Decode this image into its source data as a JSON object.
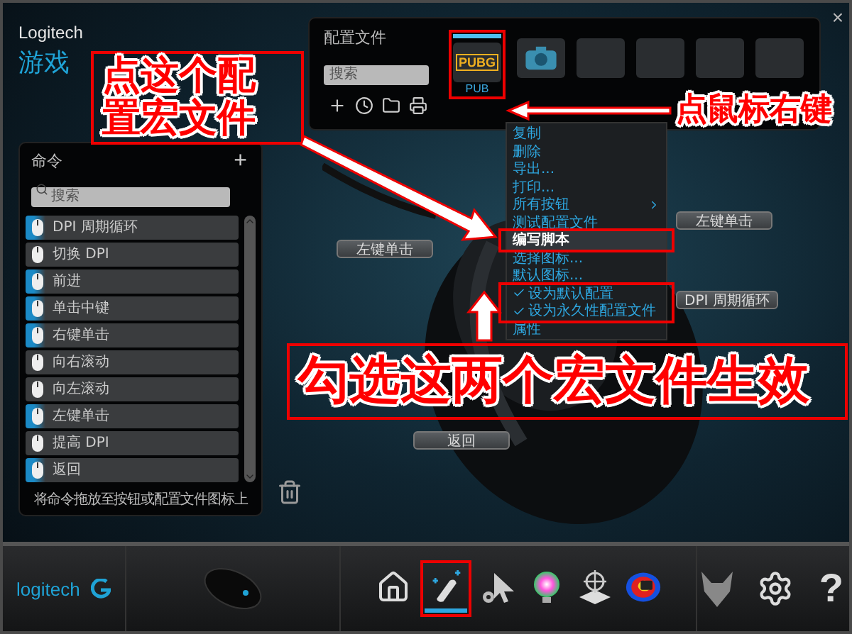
{
  "window": {
    "close": "×"
  },
  "app_title": {
    "brand": "Logitech",
    "name": "游戏"
  },
  "profiles": {
    "title": "配置文件",
    "search_placeholder": "搜索",
    "items": [
      {
        "kind": "pubg",
        "logo": "PUBG",
        "label": "PUB",
        "selected": true,
        "annotated": true
      },
      {
        "kind": "camera",
        "selected": false,
        "annotated": false
      },
      {
        "kind": "empty",
        "selected": false,
        "annotated": false
      },
      {
        "kind": "empty",
        "selected": false,
        "annotated": false
      },
      {
        "kind": "empty",
        "selected": false,
        "annotated": false
      },
      {
        "kind": "empty",
        "selected": false,
        "annotated": false
      }
    ]
  },
  "commands": {
    "title": "命令",
    "add": "+",
    "search_placeholder": "搜索",
    "items": [
      {
        "label": "DPI 周期循环",
        "assigned": true
      },
      {
        "label": "切换 DPI",
        "assigned": false
      },
      {
        "label": "前进",
        "assigned": true
      },
      {
        "label": "单击中键",
        "assigned": true
      },
      {
        "label": "右键单击",
        "assigned": true
      },
      {
        "label": "向右滚动",
        "assigned": false
      },
      {
        "label": "向左滚动",
        "assigned": false
      },
      {
        "label": "左键单击",
        "assigned": true
      },
      {
        "label": "提高 DPI",
        "assigned": false
      },
      {
        "label": "返回",
        "assigned": true
      }
    ],
    "hint": "将命令拖放至按钮或配置文件图标上"
  },
  "mouse_buttons": [
    {
      "label": "左键单击"
    },
    {
      "label": "左键单击"
    },
    {
      "label": "DPI 周期循环"
    },
    {
      "label": "返回"
    }
  ],
  "context_menu": [
    {
      "label": "复制",
      "kind": "item",
      "selected": false,
      "annotated": false
    },
    {
      "label": "删除",
      "kind": "item",
      "selected": false,
      "annotated": false
    },
    {
      "label": "导出...",
      "kind": "item",
      "selected": false,
      "annotated": false
    },
    {
      "label": "打印...",
      "kind": "item",
      "selected": false,
      "annotated": false
    },
    {
      "label": "所有按钮",
      "kind": "submenu",
      "selected": false,
      "annotated": false
    },
    {
      "label": "测试配置文件",
      "kind": "item",
      "selected": false,
      "annotated": false
    },
    {
      "label": "编写脚本",
      "kind": "item",
      "selected": true,
      "annotated": true
    },
    {
      "label": "选择图标...",
      "kind": "item",
      "selected": false,
      "annotated": false
    },
    {
      "label": "默认图标...",
      "kind": "item",
      "selected": false,
      "annotated": false
    },
    {
      "label": "设为默认配置",
      "kind": "check",
      "checked": true,
      "selected": false,
      "annotated": true
    },
    {
      "label": "设为永久性配置文件",
      "kind": "check",
      "checked": true,
      "selected": false,
      "annotated": true
    },
    {
      "label": "属性",
      "kind": "item",
      "selected": false,
      "annotated": false
    }
  ],
  "annotations": [
    {
      "text": "点这个配置宏文件"
    },
    {
      "text": "点鼠标右键"
    },
    {
      "text": "勾选这两个宏文件生效"
    }
  ],
  "bottom_bar": {
    "logo": "logitech",
    "tools": [
      {
        "kind": "home",
        "selected": false,
        "annotated": false
      },
      {
        "kind": "customize",
        "selected": true,
        "annotated": true
      },
      {
        "kind": "pointer",
        "selected": false,
        "annotated": false
      },
      {
        "kind": "lighting",
        "selected": false,
        "annotated": false
      },
      {
        "kind": "surface",
        "selected": false,
        "annotated": false
      },
      {
        "kind": "heatmap",
        "selected": false,
        "annotated": false
      }
    ],
    "help": "?"
  }
}
